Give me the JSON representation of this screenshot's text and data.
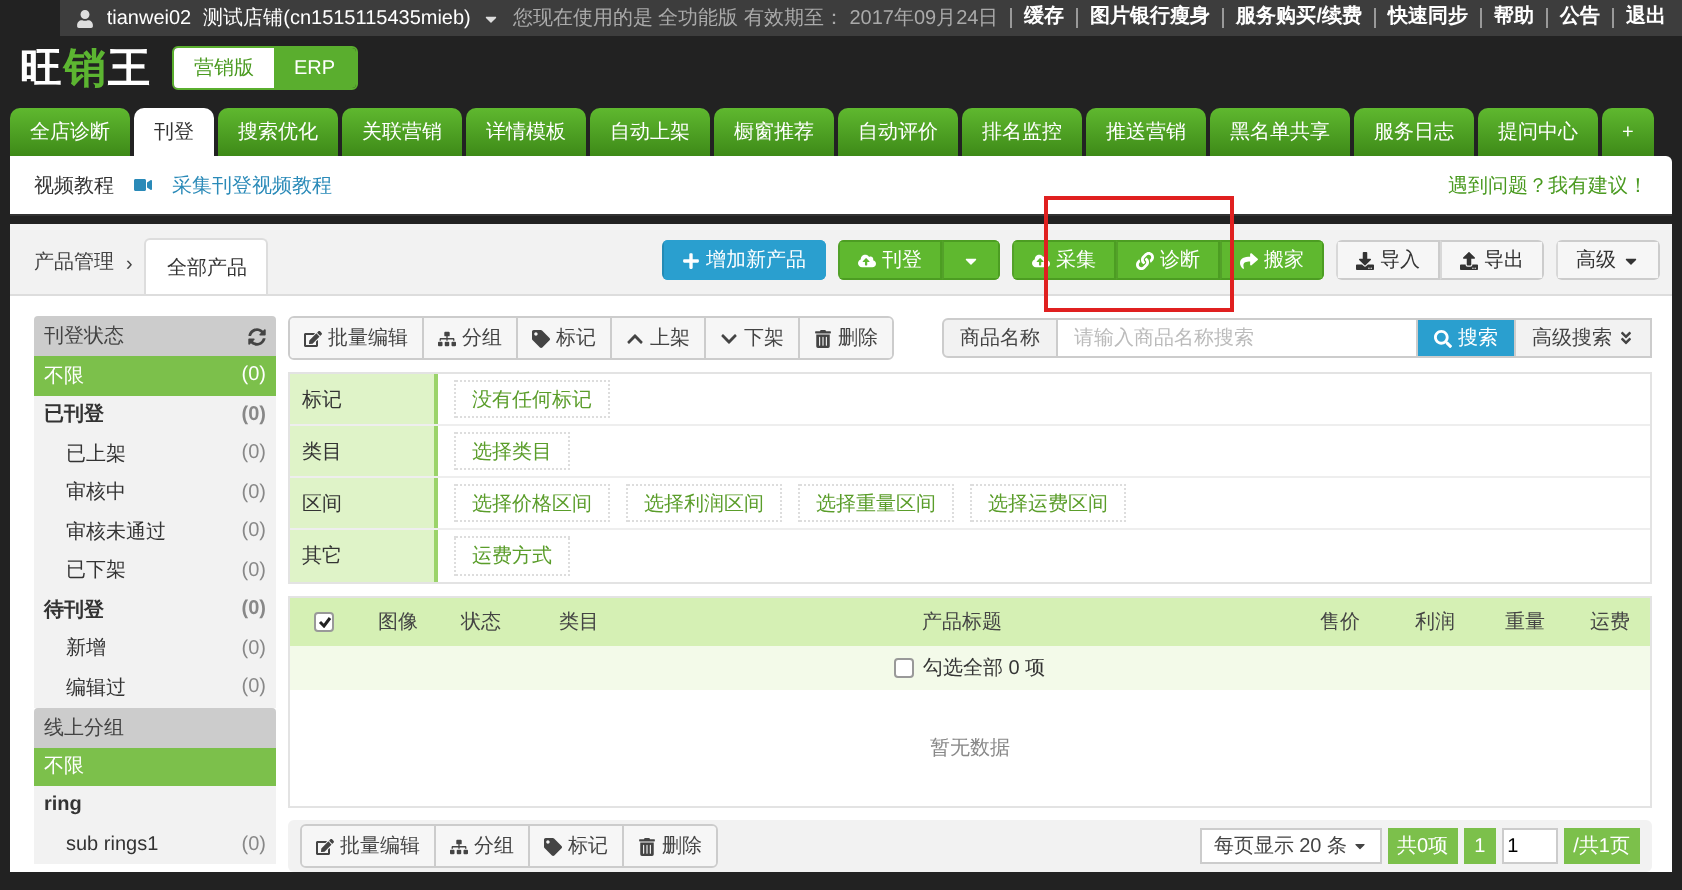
{
  "top_bar": {
    "user": "tianwei02",
    "shop": "测试店铺(cn1515115435mieb)",
    "notice": "您现在使用的是 全功能版 有效期至： 2017年09月24日",
    "links": [
      "缓存",
      "图片银行瘦身",
      "服务购买/续费",
      "快速同步",
      "帮助",
      "公告",
      "退出"
    ]
  },
  "logo_parts": [
    "旺",
    "销",
    "王"
  ],
  "editions": [
    {
      "label": "营销版",
      "selected": true
    },
    {
      "label": "ERP",
      "selected": false
    }
  ],
  "nav_tabs": [
    {
      "label": "全店诊断",
      "selected": false
    },
    {
      "label": "刊登",
      "selected": true
    },
    {
      "label": "搜索优化",
      "selected": false
    },
    {
      "label": "关联营销",
      "selected": false
    },
    {
      "label": "详情模板",
      "selected": false
    },
    {
      "label": "自动上架",
      "selected": false
    },
    {
      "label": "橱窗推荐",
      "selected": false
    },
    {
      "label": "自动评价",
      "selected": false
    },
    {
      "label": "排名监控",
      "selected": false
    },
    {
      "label": "推送营销",
      "selected": false
    },
    {
      "label": "黑名单共享",
      "selected": false
    },
    {
      "label": "服务日志",
      "selected": false
    },
    {
      "label": "提问中心",
      "selected": false
    },
    {
      "label": "+",
      "selected": false
    }
  ],
  "sub_bar": {
    "label": "视频教程",
    "video_link": "采集刊登视频教程",
    "feedback": "遇到问题？我有建议！"
  },
  "breadcrumb": {
    "root": "产品管理",
    "separator": "›",
    "tab": "全部产品"
  },
  "action_groups": [
    {
      "buttons": [
        "增加新产品"
      ]
    },
    {
      "buttons": [
        "刊登"
      ]
    },
    {
      "buttons": [
        "采集",
        "诊断",
        "搬家"
      ]
    },
    {
      "buttons": [
        "导入",
        "导出"
      ]
    },
    {
      "buttons": [
        "高级"
      ]
    }
  ],
  "sidebar": [
    {
      "title": "刊登状态",
      "items": [
        {
          "label": "不限",
          "count": "(0)",
          "kind": "option",
          "selected": true
        },
        {
          "label": "已刊登",
          "count": "(0)",
          "kind": "group",
          "selected": false
        },
        {
          "label": "已上架",
          "count": "(0)",
          "kind": "sub",
          "selected": false
        },
        {
          "label": "审核中",
          "count": "(0)",
          "kind": "sub",
          "selected": false
        },
        {
          "label": "审核未通过",
          "count": "(0)",
          "kind": "sub",
          "selected": false
        },
        {
          "label": "已下架",
          "count": "(0)",
          "kind": "sub",
          "selected": false
        },
        {
          "label": "待刊登",
          "count": "(0)",
          "kind": "group",
          "selected": false
        },
        {
          "label": "新增",
          "count": "(0)",
          "kind": "sub",
          "selected": false
        },
        {
          "label": "编辑过",
          "count": "(0)",
          "kind": "sub",
          "selected": false
        }
      ]
    },
    {
      "title": "线上分组",
      "items": [
        {
          "label": "不限",
          "kind": "option",
          "selected": true
        },
        {
          "label": "ring",
          "kind": "group",
          "selected": false
        },
        {
          "label": "sub rings1",
          "count": "(0)",
          "kind": "sub",
          "selected": false
        }
      ]
    }
  ],
  "toolbar": [
    "批量编辑",
    "分组",
    "标记",
    "上架",
    "下架",
    "删除"
  ],
  "search": {
    "field_label": "商品名称",
    "placeholder": "请输入商品名称搜索",
    "button": "搜索",
    "advanced": "高级搜索"
  },
  "filters": [
    {
      "label": "标记",
      "options": [
        "没有任何标记"
      ]
    },
    {
      "label": "类目",
      "options": [
        "选择类目"
      ]
    },
    {
      "label": "区间",
      "options": [
        "选择价格区间",
        "选择利润区间",
        "选择重量区间",
        "选择运费区间"
      ]
    },
    {
      "label": "其它",
      "options": [
        "运费方式"
      ]
    }
  ],
  "table": {
    "header_checked": true,
    "columns": [
      "图像",
      "状态",
      "类目",
      "产品标题",
      "售价",
      "利润",
      "重量",
      "运费"
    ],
    "select_all_checked": false,
    "select_all": "勾选全部 0 项",
    "empty": "暂无数据"
  },
  "bottom_toolbar": [
    "批量编辑",
    "分组",
    "标记",
    "删除"
  ],
  "pagination": {
    "page_size": "每页显示 20 条",
    "total": "共0项",
    "current": "1",
    "page_input": "1",
    "pages": "/共1页"
  }
}
